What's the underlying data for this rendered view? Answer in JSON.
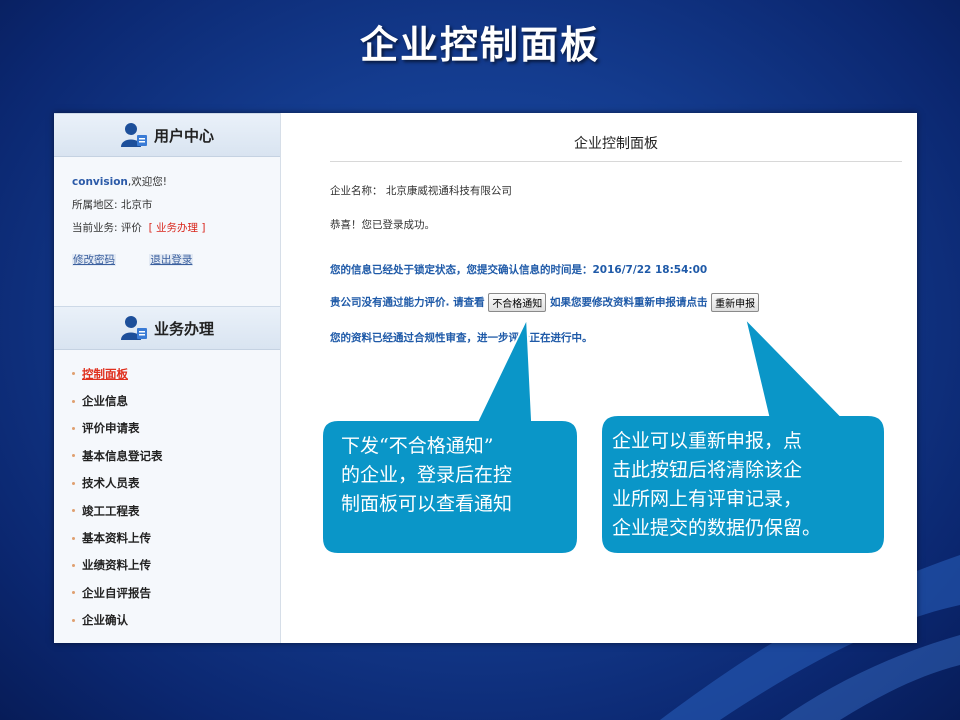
{
  "slide": {
    "title": "企业控制面板"
  },
  "sidebar": {
    "user_center_title": "用户中心",
    "username": "convision",
    "welcome": ",欢迎您!",
    "region_label": "所属地区: ",
    "region_value": "北京市",
    "business_label": "当前业务: 评价",
    "business_link_open": "[ ",
    "business_link": "业务办理",
    "business_link_close": " ]",
    "change_password": "修改密码",
    "logout": "退出登录",
    "biz_title": "业务办理",
    "menu": [
      {
        "label": "控制面板",
        "active": true
      },
      {
        "label": "企业信息"
      },
      {
        "label": "评价申请表"
      },
      {
        "label": "基本信息登记表"
      },
      {
        "label": "技术人员表"
      },
      {
        "label": "竣工工程表"
      },
      {
        "label": "基本资料上传"
      },
      {
        "label": "业绩资料上传"
      },
      {
        "label": "企业自评报告"
      },
      {
        "label": "企业确认"
      }
    ]
  },
  "main": {
    "title": "企业控制面板",
    "company_label": "企业名称：",
    "company_name": "北京康威视通科技有限公司",
    "login_success": "恭喜！您已登录成功。",
    "locked_status": "您的信息已经处于锁定状态，您提交确认信息的时间是：2016/7/22 18:54:00",
    "fail_text": "贵公司没有通过能力评价. 请查看",
    "fail_notice_button": "不合格通知",
    "reapply_text": "如果您要修改资料重新申报请点击",
    "reapply_button": "重新申报",
    "review_status": "您的资料已经通过合规性审查，进一步评价正在进行中。"
  },
  "callouts": {
    "left": [
      "下发“不合格通知”",
      "的企业，登录后在控",
      "制面板可以查看通知"
    ],
    "right": [
      "企业可以重新申报，点",
      "击此按钮后将清除该企",
      "业所网上有评审记录，",
      "企业提交的数据仍保留。"
    ]
  },
  "colors": {
    "callout_fill": "#0a96c8",
    "callout_border": "#ffffff",
    "accent_red": "#d9261c",
    "status_blue": "#1f5aa8"
  }
}
